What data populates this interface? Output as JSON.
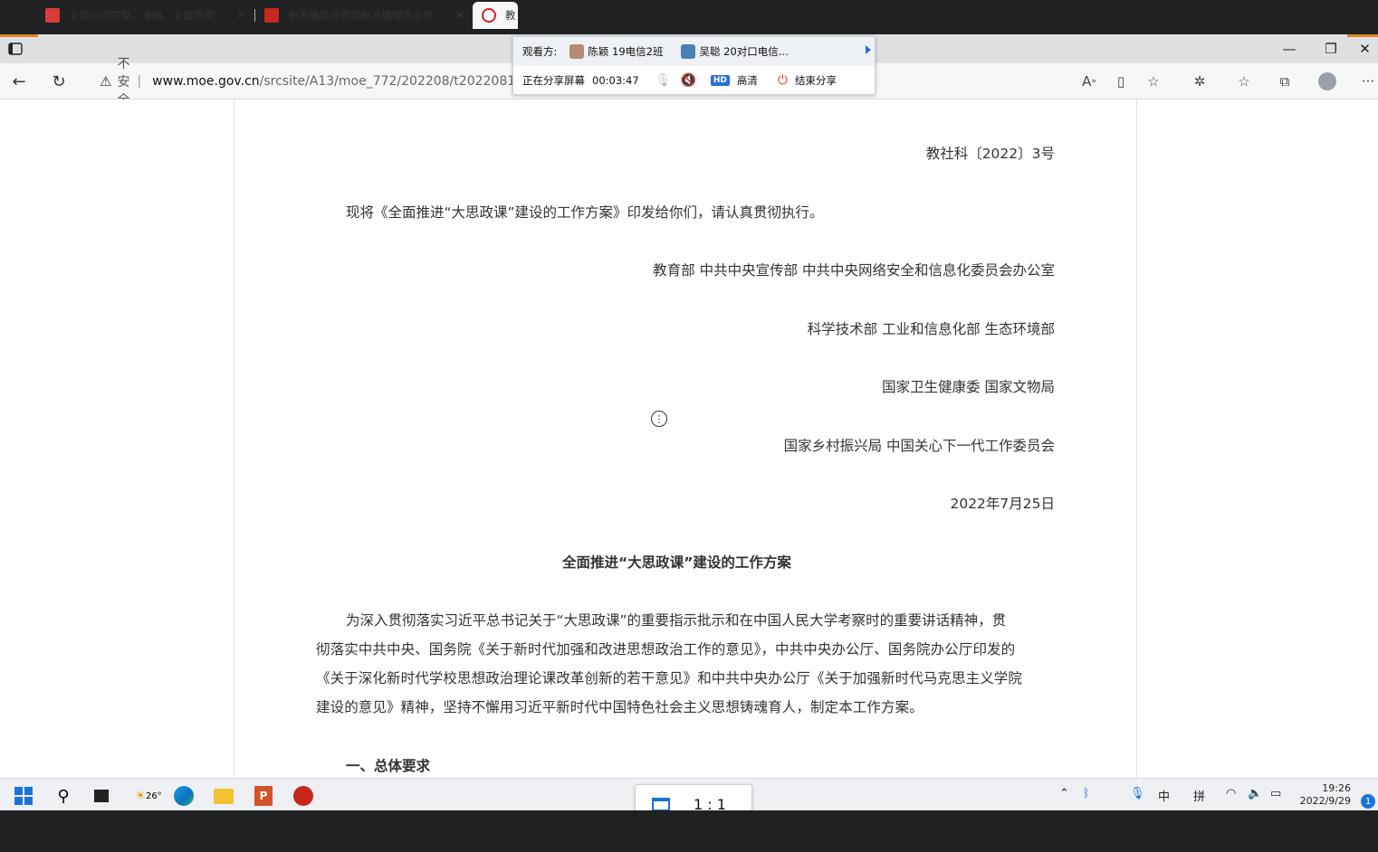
{
  "browser": {
    "tabs": [
      {
        "title": "全党必须完整、准确、全面贯彻",
        "favicon_color": "#d73c3c"
      },
      {
        "title": "新发展阶段贯彻新发展理念必然",
        "favicon_color": "#c8281e"
      },
      {
        "title": "教",
        "favicon_color": "#d51f1f"
      }
    ],
    "address": {
      "warning": "不安全",
      "domain": "www.moe.gov.cn",
      "path": "/srcsite/A13/moe_772/202208/t20220818"
    }
  },
  "share_popup": {
    "viewers_label": "观看方:",
    "viewers": [
      {
        "name": "陈颖  19电信2班"
      },
      {
        "name": "吴聪 20对口电信..."
      }
    ],
    "sharing_label": "正在分享屏幕",
    "timer": "00:03:47",
    "hd_label": "HD",
    "quality": "高清",
    "stop_label": "结束分享"
  },
  "document": {
    "doc_number": "教社科〔2022〕3号",
    "intro": "现将《全面推进“大思政课”建设的工作方案》印发给你们，请认真贯彻执行。",
    "issuers": [
      "教育部 中共中央宣传部 中共中央网络安全和信息化委员会办公室",
      "科学技术部 工业和信息化部 生态环境部",
      "国家卫生健康委 国家文物局",
      "国家乡村振兴局 中国关心下一代工作委员会"
    ],
    "date": "2022年7月25日",
    "title": "全面推进“大思政课”建设的工作方案",
    "paragraph_lines": [
      "为深入贯彻落实习近平总书记关于“大思政课”的重要指示批示和在中国人民大学考察时的重要讲话精神，贯",
      "彻落实中共中央、国务院《关于新时代加强和改进思想政治工作的意见》，中共中央办公厅、国务院办公厅印发的",
      "《关于深化新时代学校思想政治理论课改革创新的若干意见》和中共中央办公厅《关于加强新时代马克思主义学院",
      "建设的意见》精神，坚持不懈用习近平新时代中国特色社会主义思想铸魂育人，制定本工作方案。"
    ],
    "section_1": "一、总体要求"
  },
  "taskbar": {
    "weather_temp": "26°",
    "ime_1": "中",
    "ime_2": "拼",
    "time": "19:26",
    "date": "2022/9/29",
    "notifications": "1",
    "ratio": "1 : 1"
  }
}
